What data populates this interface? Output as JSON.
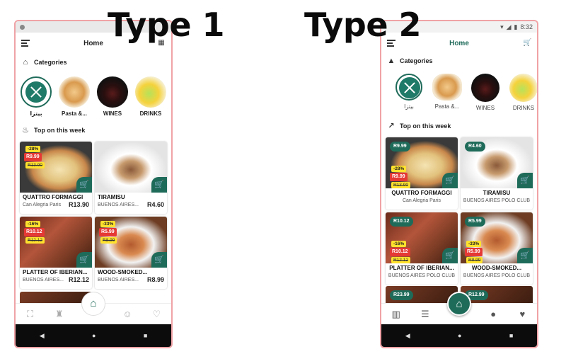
{
  "headings": {
    "type1": "Type 1",
    "type2": "Type 2"
  },
  "app": {
    "title": "Home",
    "status_time": "8:32",
    "categories_label": "Categories",
    "top_label": "Top on this week"
  },
  "categories": [
    {
      "label": "بيتزا",
      "icon": "fork-knife-logo"
    },
    {
      "label": "Pasta &...",
      "icon": "pasta-image"
    },
    {
      "label": "WINES",
      "icon": "wine-image"
    },
    {
      "label": "DRINKS",
      "icon": "drink-image"
    }
  ],
  "products": [
    {
      "name": "QUATTRO FORMAGGI",
      "restaurant": "Can Alegria Paris",
      "price": "R13.90",
      "discount": "-28%",
      "sale_price": "R9.99",
      "old_price": "R13.90",
      "type2_price": "R9.99"
    },
    {
      "name": "TIRAMISU",
      "restaurant": "BUENOS AIRES...",
      "restaurant_full": "BUENOS AIRES POLO CLUB",
      "price": "R4.60",
      "type2_price": "R4.60"
    },
    {
      "name": "PLATTER OF IBERIAN...",
      "restaurant": "BUENOS AIRES...",
      "restaurant_full": "BUENOS AIRES POLO CLUB",
      "price": "R12.12",
      "discount": "-16%",
      "sale_price": "R10.12",
      "old_price": "R12.12",
      "type2_price": "R10.12"
    },
    {
      "name": "WOOD-SMOKED...",
      "restaurant": "BUENOS AIRES...",
      "restaurant_full": "BUENOS AIRES POLO CLUB",
      "price": "R8.99",
      "discount": "-33%",
      "sale_price": "R5.99",
      "old_price": "R8.99",
      "type2_price": "R5.99"
    }
  ],
  "type2_partial_prices": [
    "R23.99",
    "R12.99"
  ],
  "colors": {
    "accent": "#1f6b5a",
    "sale": "#e53935",
    "discount": "#ffe22d",
    "frame": "#f0a3a6"
  }
}
